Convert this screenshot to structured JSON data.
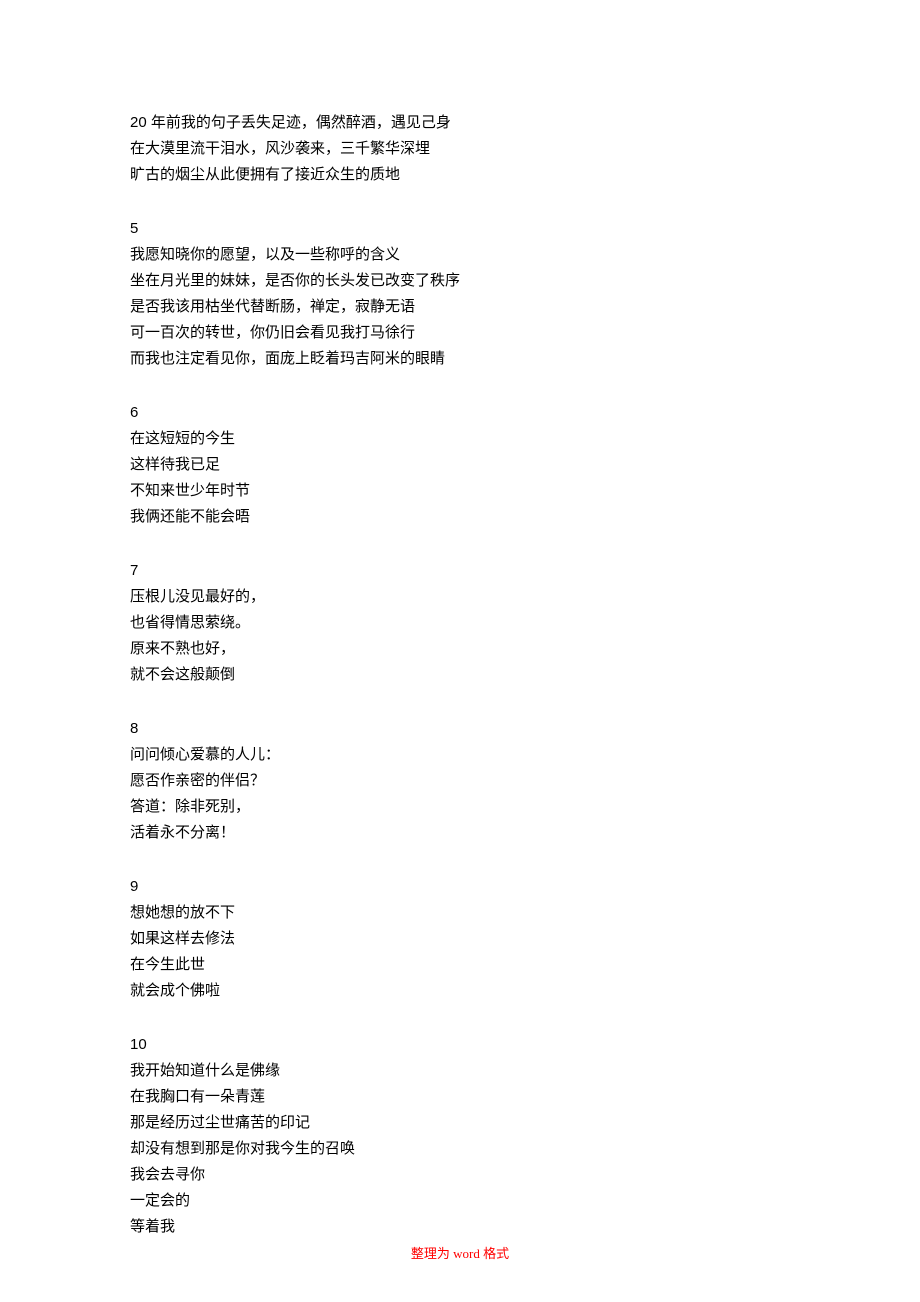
{
  "stanzas": [
    {
      "number": "",
      "lines": [
        "20 年前我的句子丢失足迹，偶然醉酒，遇见己身",
        "在大漠里流干泪水，风沙袭来，三千繁华深埋",
        "旷古的烟尘从此便拥有了接近众生的质地"
      ]
    },
    {
      "number": "5",
      "lines": [
        "我愿知晓你的愿望，以及一些称呼的含义",
        "坐在月光里的妹妹，是否你的长头发已改变了秩序",
        "是否我该用枯坐代替断肠，禅定，寂静无语",
        "可一百次的转世，你仍旧会看见我打马徐行",
        "而我也注定看见你，面庞上眨着玛吉阿米的眼睛"
      ]
    },
    {
      "number": "6",
      "lines": [
        "在这短短的今生",
        "这样待我已足",
        "不知来世少年时节",
        "我俩还能不能会晤"
      ]
    },
    {
      "number": "7",
      "lines": [
        "压根儿没见最好的，",
        "也省得情思萦绕。",
        "原来不熟也好，",
        "就不会这般颠倒"
      ]
    },
    {
      "number": "8",
      "lines": [
        "问问倾心爱慕的人儿：",
        "愿否作亲密的伴侣？",
        "答道：除非死别，",
        "活着永不分离！"
      ]
    },
    {
      "number": "9",
      "lines": [
        "想她想的放不下",
        "如果这样去修法",
        "在今生此世",
        "就会成个佛啦"
      ]
    },
    {
      "number": "10",
      "lines": [
        "我开始知道什么是佛缘",
        "在我胸口有一朵青莲",
        "那是经历过尘世痛苦的印记",
        "却没有想到那是你对我今生的召唤",
        "我会去寻你",
        "一定会的",
        "等着我"
      ]
    }
  ],
  "footer": {
    "prefix": "整理为",
    "word": " word ",
    "suffix": "格式"
  }
}
